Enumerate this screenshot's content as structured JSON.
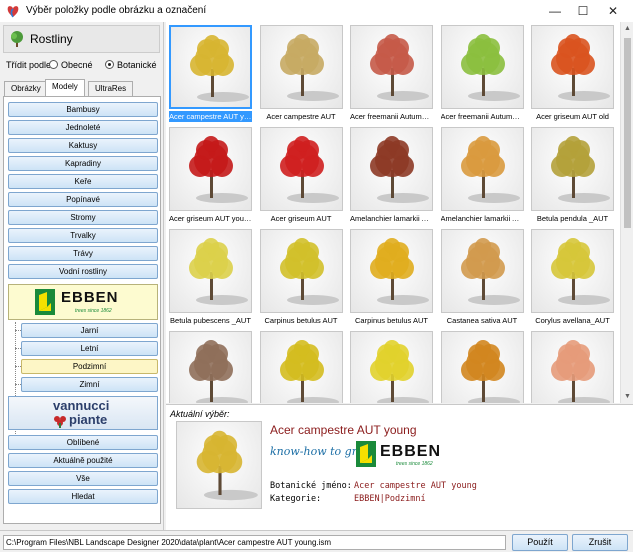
{
  "window": {
    "title": "Výběr položky podle obrázku a označení",
    "controls": {
      "minimize": "—",
      "maximize": "☐",
      "close": "✕"
    }
  },
  "left": {
    "group_title": "Rostliny",
    "sort": {
      "label": "Třídit podle",
      "options": [
        {
          "label": "Obecné",
          "selected": false
        },
        {
          "label": "Botanické",
          "selected": true
        }
      ]
    },
    "tabs": [
      {
        "label": "Obrázky",
        "active": false
      },
      {
        "label": "Modely",
        "active": true
      },
      {
        "label": "UltraRes",
        "active": false
      }
    ],
    "categories": [
      "Bambusy",
      "Jednoleté",
      "Kaktusy",
      "Kapradiny",
      "Keře",
      "Popínavé",
      "Stromy",
      "Trvalky",
      "Trávy",
      "Vodní rostliny"
    ],
    "brand1": {
      "word": "EBBEN",
      "sub": "trees since 1862"
    },
    "brand1_items": [
      {
        "label": "Jarní",
        "selected": false
      },
      {
        "label": "Letní",
        "selected": false
      },
      {
        "label": "Podzimní",
        "selected": true
      },
      {
        "label": "Zimní",
        "selected": false
      }
    ],
    "brand2": {
      "line1": "vannucci",
      "line2": "piante"
    },
    "bottom_buttons": [
      "Oblíbené",
      "Aktuálně použité",
      "Vše",
      "Hledat"
    ]
  },
  "grid": {
    "items": [
      {
        "label": "Acer campestre AUT young",
        "color": "#d7b531",
        "selected": true
      },
      {
        "label": "Acer campestre AUT",
        "color": "#c6aa63",
        "selected": false
      },
      {
        "label": "Acer freemanii Autumn Blaze",
        "color": "#c55a48",
        "selected": false
      },
      {
        "label": "Acer freemanii Autumn Blaze young",
        "color": "#8bbf3e",
        "selected": false
      },
      {
        "label": "Acer griseum AUT old",
        "color": "#d9531f",
        "selected": false
      },
      {
        "label": "Acer griseum AUT young",
        "color": "#c41a1a",
        "selected": false
      },
      {
        "label": "Acer griseum AUT",
        "color": "#cf1f1f",
        "selected": false
      },
      {
        "label": "Amelanchier lamarkii AUT",
        "color": "#8d3a26",
        "selected": false
      },
      {
        "label": "Amelanchier lamarkii AUT young",
        "color": "#d99a3e",
        "selected": false
      },
      {
        "label": "Betula pendula _AUT",
        "color": "#b4a13a",
        "selected": false
      },
      {
        "label": "Betula pubescens _AUT",
        "color": "#dcd04a",
        "selected": false
      },
      {
        "label": "Carpinus betulus AUT",
        "color": "#d1c02a",
        "selected": false
      },
      {
        "label": "Carpinus betulus AUT",
        "color": "#e0ad1e",
        "selected": false
      },
      {
        "label": "Castanea sativa AUT",
        "color": "#d19a4e",
        "selected": false
      },
      {
        "label": "Corylus avellana_AUT",
        "color": "#d6c73a",
        "selected": false
      },
      {
        "label": "",
        "color": "#8f6f5a",
        "selected": false
      },
      {
        "label": "",
        "color": "#d4bd1f",
        "selected": false
      },
      {
        "label": "",
        "color": "#e1d12c",
        "selected": false
      },
      {
        "label": "",
        "color": "#d1861f",
        "selected": false
      },
      {
        "label": "",
        "color": "#e59b7a",
        "selected": false
      }
    ]
  },
  "detail": {
    "caption": "Aktuální výběr:",
    "name": "Acer campestre AUT young",
    "slogan": "know-how to grow",
    "brand_word": "EBBEN",
    "brand_sub": "trees since 1862",
    "fields": [
      {
        "label": "Botanické jméno:",
        "value": "Acer campestre AUT young"
      },
      {
        "label": "Kategorie:",
        "value": "EBBEN|Podzimní"
      }
    ],
    "color": "#d7b531"
  },
  "status": {
    "path": "C:\\Program Files\\NBL Landscape Designer 2020\\data\\plant\\Acer campestre AUT young.ism",
    "use_label": "Použít",
    "cancel_label": "Zrušit"
  }
}
